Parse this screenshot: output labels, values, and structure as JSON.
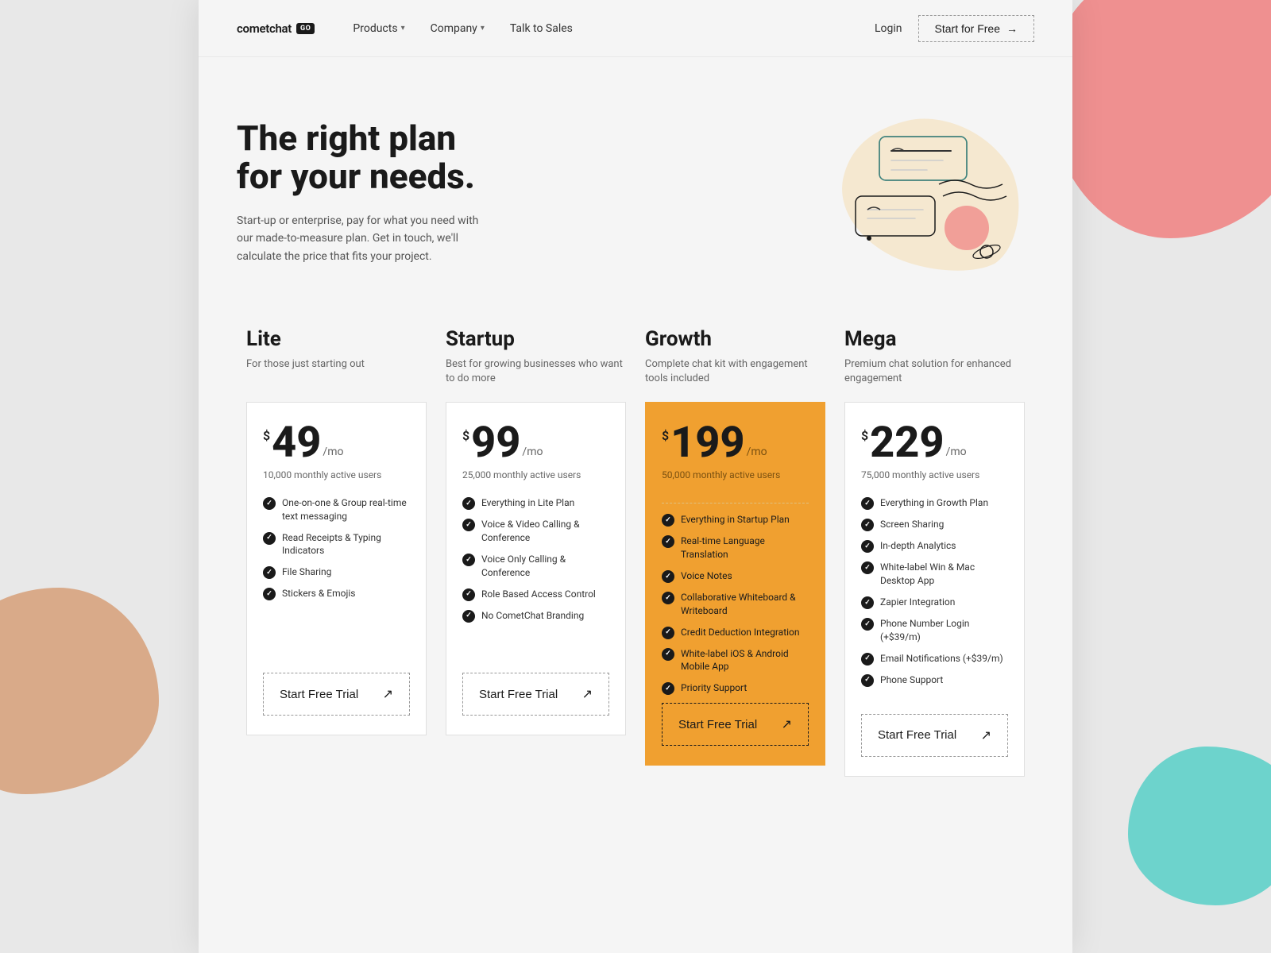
{
  "brand": {
    "name": "cometchat",
    "badge": "GO"
  },
  "nav": {
    "links": [
      {
        "label": "Products",
        "hasDropdown": true
      },
      {
        "label": "Company",
        "hasDropdown": true
      },
      {
        "label": "Talk to Sales",
        "hasDropdown": false
      }
    ],
    "login_label": "Login",
    "cta_label": "Start for Free"
  },
  "hero": {
    "title": "The right plan\nfor your needs.",
    "subtitle": "Start-up or enterprise, pay for what you need with our made-to-measure plan. Get in touch, we'll calculate the price that fits your project."
  },
  "plans": [
    {
      "id": "lite",
      "name": "Lite",
      "desc": "For those just starting out",
      "price": "49",
      "period": "/mo",
      "users": "10,000 monthly active users",
      "featured": false,
      "features": [
        "One-on-one & Group real-time text messaging",
        "Read Receipts & Typing Indicators",
        "File Sharing",
        "Stickers & Emojis"
      ],
      "cta": "Start Free Trial"
    },
    {
      "id": "startup",
      "name": "Startup",
      "desc": "Best for growing businesses who want to do more",
      "price": "99",
      "period": "/mo",
      "users": "25,000 monthly active users",
      "featured": false,
      "features": [
        "Everything in Lite Plan",
        "Voice & Video Calling & Conference",
        "Voice Only Calling & Conference",
        "Role Based Access Control",
        "No CometChat Branding"
      ],
      "cta": "Start Free Trial"
    },
    {
      "id": "growth",
      "name": "Growth",
      "desc": "Complete chat kit with engagement tools included",
      "price": "199",
      "period": "/mo",
      "users": "50,000 monthly active users",
      "featured": true,
      "features": [
        "Everything in Startup Plan",
        "Real-time Language Translation",
        "Voice Notes",
        "Collaborative Whiteboard & Writeboard",
        "Credit Deduction Integration",
        "White-label iOS & Android Mobile App",
        "Priority Support"
      ],
      "cta": "Start Free Trial"
    },
    {
      "id": "mega",
      "name": "Mega",
      "desc": "Premium chat solution for enhanced engagement",
      "price": "229",
      "period": "/mo",
      "users": "75,000 monthly active users",
      "featured": false,
      "features": [
        "Everything in Growth Plan",
        "Screen Sharing",
        "In-depth Analytics",
        "White-label Win & Mac Desktop App",
        "Zapier Integration",
        "Phone Number Login (+$39/m)",
        "Email Notifications (+$39/m)",
        "Phone Support"
      ],
      "cta": "Start Free Trial"
    }
  ],
  "colors": {
    "featured_bg": "#f0a030",
    "accent": "#1a1a1a"
  }
}
